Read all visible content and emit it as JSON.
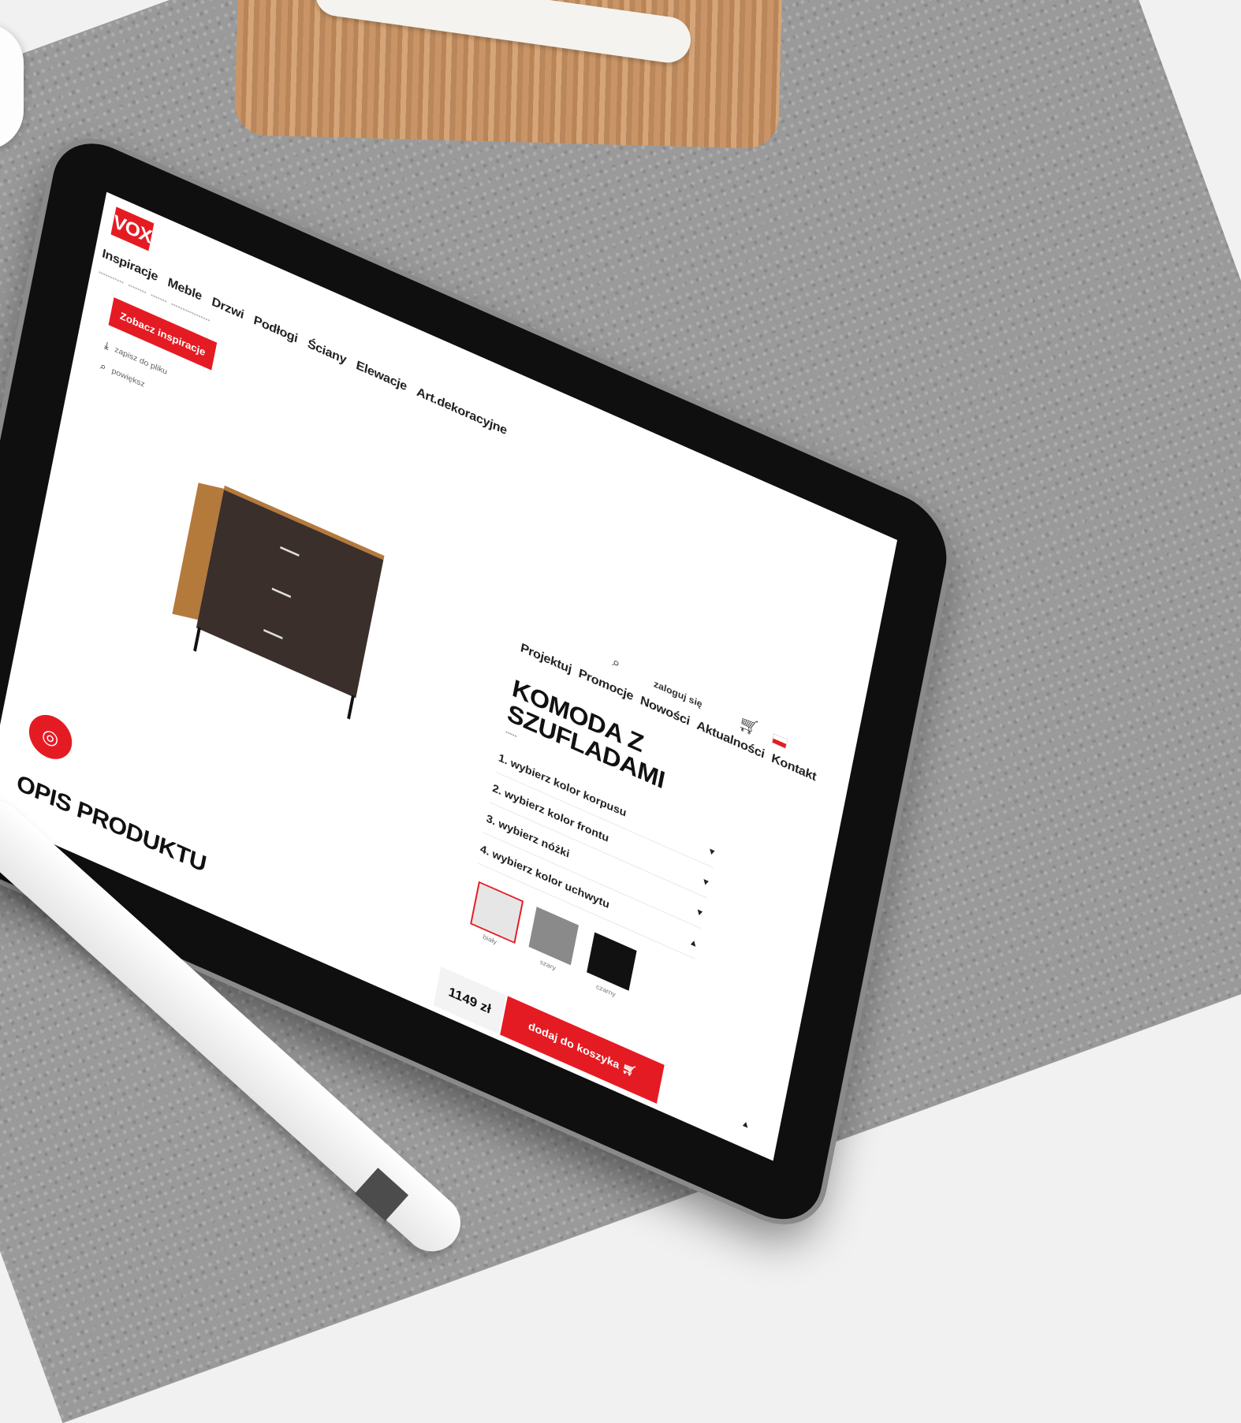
{
  "brand": {
    "logo_text": "VOX",
    "accent_color": "#e51b23"
  },
  "nav": {
    "primary": [
      "Inspiracje",
      "Meble",
      "Drzwi",
      "Podłogi",
      "Ściany",
      "Elewacje",
      "Art.dekoracyjne"
    ],
    "secondary": [
      "Projektuj",
      "Promocje",
      "Nowości",
      "Aktualności",
      "Kontakt"
    ]
  },
  "header": {
    "login_label": "zaloguj się",
    "search_icon": "search-icon",
    "cart_icon": "cart-icon",
    "language_flag": "flag-pl"
  },
  "left_panel": {
    "cta_label": "Zobacz inspiracje",
    "download_label": "zapisz do pliku",
    "zoom_label": "powiększ"
  },
  "product": {
    "title_line1": "KOMODA Z",
    "title_line2": "SZUFLADAMI",
    "options": [
      "1. wybierz kolor korpusu",
      "2. wybierz kolor frontu",
      "3. wybierz nóżki",
      "4. wybierz kolor uchwytu"
    ],
    "swatches": [
      {
        "label": "biały",
        "color": "#e6e6e6",
        "selected": true
      },
      {
        "label": "szary",
        "color": "#8a8a8a",
        "selected": false
      },
      {
        "label": "czarny",
        "color": "#111111",
        "selected": false
      }
    ],
    "price": "1149 zł",
    "add_to_cart_label": "dodaj do koszyka"
  },
  "sections": {
    "description_heading": "OPIS PRODUKTU"
  }
}
